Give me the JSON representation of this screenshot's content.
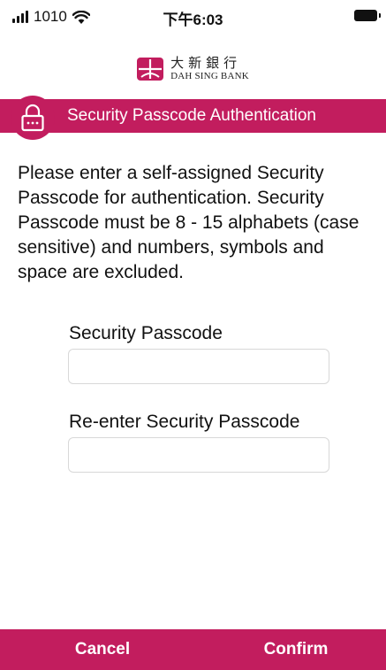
{
  "status_bar": {
    "carrier": "1010",
    "time": "下午6:03",
    "icons": [
      "signal-icon",
      "wifi-icon",
      "battery-icon"
    ]
  },
  "logo": {
    "chinese": "大新銀行",
    "english": "DAH SING BANK"
  },
  "header": {
    "title": "Security Passcode Authentication",
    "icon": "lock-icon"
  },
  "instructions": "Please enter a self-assigned Security Passcode for authentication. Security Passcode must be 8 - 15 alphabets (case sensitive) and numbers, symbols and space are excluded.",
  "fields": [
    {
      "label": "Security Passcode",
      "value": "",
      "placeholder": ""
    },
    {
      "label": "Re-enter Security Passcode",
      "value": "",
      "placeholder": ""
    }
  ],
  "buttons": {
    "cancel": "Cancel",
    "confirm": "Confirm"
  },
  "colors": {
    "brand": "#c21d5e",
    "background": "#ffffff",
    "text": "#111111"
  }
}
